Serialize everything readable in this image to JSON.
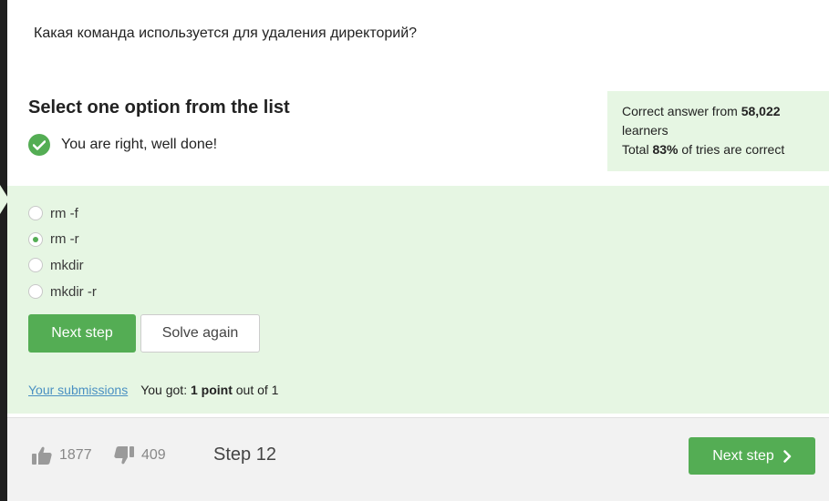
{
  "question": {
    "text": "Какая команда используется для удаления директорий?"
  },
  "quiz": {
    "title": "Select one option from the list",
    "feedback": "You are right, well done!",
    "options": [
      {
        "label": "rm -f",
        "selected": false
      },
      {
        "label": "rm -r",
        "selected": true
      },
      {
        "label": "mkdir",
        "selected": false
      },
      {
        "label": "mkdir -r",
        "selected": false
      }
    ],
    "next_button": "Next step",
    "solve_again_button": "Solve again",
    "submissions_link": "Your submissions",
    "score_prefix": "You got:",
    "score_points": "1 point",
    "score_suffix": "out of 1"
  },
  "stats": {
    "line1_prefix": "Correct answer from",
    "learners_count": "58,022",
    "line1_suffix": "learners",
    "line2_prefix": "Total",
    "percent": "83%",
    "line2_suffix": "of tries are correct"
  },
  "footer": {
    "likes": "1877",
    "dislikes": "409",
    "step": "Step 12",
    "next_button": "Next step"
  },
  "colors": {
    "accent": "#54ad54",
    "success_bg": "#e6f6e3",
    "link": "#4a90c2"
  },
  "icons": {
    "feedback": "check-circle-icon",
    "like": "thumbs-up-icon",
    "dislike": "thumbs-down-icon",
    "next": "chevron-right-icon"
  }
}
